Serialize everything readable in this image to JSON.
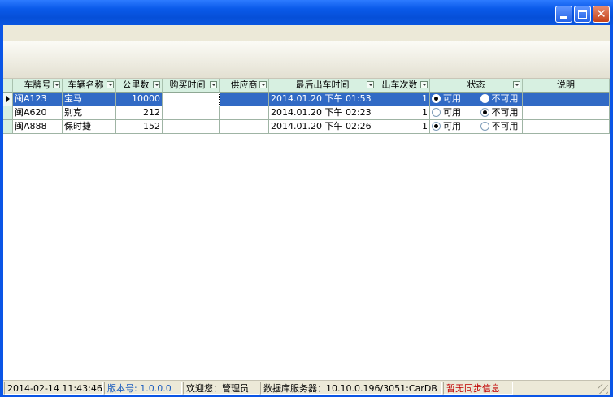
{
  "colors": {
    "title_gradient_top": "#2D7BFF",
    "header_bg": "#D7F0E1",
    "selection": "#316AC5",
    "version_text": "#1F5FBF",
    "sync_text": "#C00000"
  },
  "grid": {
    "columns": [
      {
        "label": "车牌号"
      },
      {
        "label": "车辆名称"
      },
      {
        "label": "公里数"
      },
      {
        "label": "购买时间"
      },
      {
        "label": "供应商"
      },
      {
        "label": "最后出车时间"
      },
      {
        "label": "出车次数"
      },
      {
        "label": "状态"
      },
      {
        "label": "说明"
      }
    ],
    "status_options": [
      "可用",
      "不可用"
    ],
    "rows": [
      {
        "plate": "闽A123",
        "name": "宝马",
        "km": "10000",
        "buy": "",
        "supplier": "",
        "last_out": "2014.01.20 下午 01:53",
        "count": "1",
        "status": "可用",
        "note": ""
      },
      {
        "plate": "闽A620",
        "name": "别克",
        "km": "212",
        "buy": "",
        "supplier": "",
        "last_out": "2014.01.20 下午 02:23",
        "count": "1",
        "status": "不可用",
        "note": ""
      },
      {
        "plate": "闽A888",
        "name": "保时捷",
        "km": "152",
        "buy": "",
        "supplier": "",
        "last_out": "2014.01.20 下午 02:26",
        "count": "1",
        "status": "可用",
        "note": ""
      }
    ]
  },
  "statusbar": {
    "datetime": "2014-02-14 11:43:46",
    "version": "版本号: 1.0.0.0",
    "welcome": "欢迎您：管理员",
    "db": "数据库服务器：10.10.0.196/3051:CarDB",
    "sync": "暂无同步信息"
  }
}
